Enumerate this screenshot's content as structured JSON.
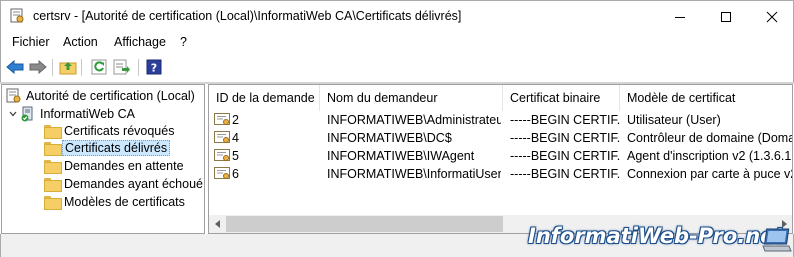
{
  "window": {
    "title": "certsrv - [Autorité de certification (Local)\\InformatiWeb CA\\Certificats délivrés]",
    "controls": [
      "minimize",
      "maximize",
      "close"
    ]
  },
  "menubar": {
    "items": [
      {
        "label": "Fichier"
      },
      {
        "label": "Action"
      },
      {
        "label": "Affichage"
      },
      {
        "label": "?"
      }
    ]
  },
  "toolbar": {
    "icons": [
      "back-arrow-icon",
      "forward-arrow-icon",
      "up-folder-icon",
      "refresh-icon",
      "export-list-icon",
      "help-icon"
    ]
  },
  "tree": {
    "root": {
      "label": "Autorité de certification (Local)",
      "icon": "certsrv-icon"
    },
    "ca": {
      "label": "InformatiWeb CA",
      "icon": "ca-server-icon",
      "expanded": true
    },
    "folders": [
      {
        "label": "Certificats révoqués",
        "selected": false
      },
      {
        "label": "Certificats délivrés",
        "selected": true
      },
      {
        "label": "Demandes en attente",
        "selected": false
      },
      {
        "label": "Demandes ayant échoué",
        "selected": false
      },
      {
        "label": "Modèles de certificats",
        "selected": false
      }
    ]
  },
  "list": {
    "columns": [
      "ID de la demande",
      "Nom du demandeur",
      "Certificat binaire",
      "Modèle de certificat"
    ],
    "rows": [
      {
        "id": "2",
        "requester": "INFORMATIWEB\\Administrateur",
        "binary": "-----BEGIN CERTIF...",
        "template": "Utilisateur (User)"
      },
      {
        "id": "4",
        "requester": "INFORMATIWEB\\DC$",
        "binary": "-----BEGIN CERTIF...",
        "template": "Contrôleur de domaine (Doma"
      },
      {
        "id": "5",
        "requester": "INFORMATIWEB\\IWAgent",
        "binary": "-----BEGIN CERTIF...",
        "template": "Agent d'inscription v2 (1.3.6.1.4"
      },
      {
        "id": "6",
        "requester": "INFORMATIWEB\\InformatiUser",
        "binary": "-----BEGIN CERTIF...",
        "template": "Connexion par carte à puce v2"
      }
    ]
  },
  "watermark": {
    "text": "InformatiWeb-Pro.net"
  },
  "colors": {
    "selection": "#cce8ff",
    "folder": "#f5cf66",
    "watermark_outline": "#1a4d8a"
  }
}
